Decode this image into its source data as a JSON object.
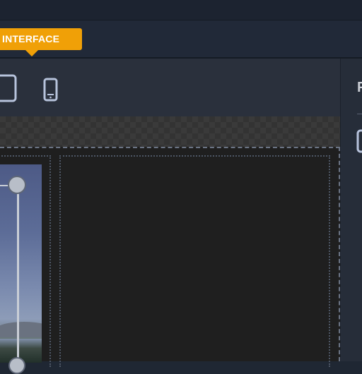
{
  "header": {
    "tag_label": "INTERFACE"
  },
  "toolbar": {
    "icons": [
      "tablet-icon",
      "phone-icon"
    ]
  },
  "panel": {
    "heading": "P"
  },
  "colors": {
    "accent": "#f0a007",
    "background": "#1f2733",
    "canvas": "#1f1f1f",
    "guide": "#6b7484",
    "icon": "#b7c3dc"
  }
}
